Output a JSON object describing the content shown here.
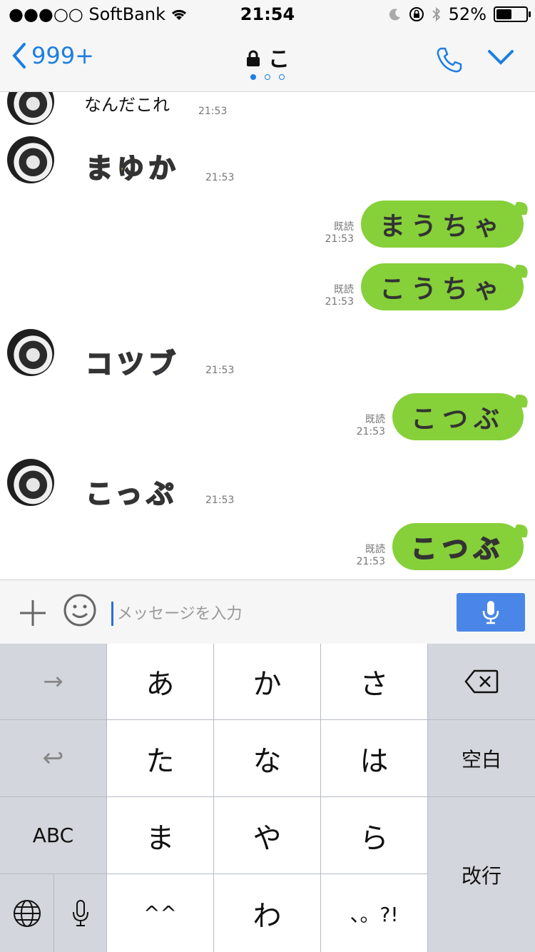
{
  "status_bar": {
    "carrier": "●●●○○ SoftBank",
    "time": "21:54",
    "battery": "52%",
    "battery_fraction": 0.52
  },
  "nav": {
    "back_label": "999+",
    "title": "こ",
    "page_dots": 3,
    "active_dot": 0
  },
  "messages": {
    "m1": {
      "text": "なんだこれ",
      "time": "21:53"
    },
    "m2": {
      "sticker": "まゆか",
      "time": "21:53"
    },
    "m3": {
      "text": "まうちゃ",
      "read": "既読",
      "time": "21:53"
    },
    "m4": {
      "text": "こうちゃ",
      "read": "既読",
      "time": "21:53"
    },
    "m5": {
      "sticker": "コツブ",
      "time": "21:53"
    },
    "m6": {
      "text": "こつぶ",
      "read": "既読",
      "time": "21:53"
    },
    "m7": {
      "sticker": "こっぷ",
      "time": "21:53"
    },
    "m8": {
      "text": "こつぶ",
      "read": "既読",
      "time": "21:53"
    }
  },
  "input": {
    "placeholder": "メッセージを入力",
    "value": ""
  },
  "keyboard": {
    "rows": [
      [
        "→",
        "あ",
        "か",
        "さ",
        "⌫"
      ],
      [
        "↩",
        "た",
        "な",
        "は",
        "空白"
      ],
      [
        "ABC",
        "ま",
        "や",
        "ら",
        "改行"
      ],
      [
        "🌐",
        "🎤",
        "^^",
        "わ",
        "、。?!"
      ]
    ],
    "next_label": "→",
    "undo_label": "↩",
    "abc_label": "ABC",
    "space_label": "空白",
    "return_label": "改行",
    "a": "あ",
    "ka": "か",
    "sa": "さ",
    "ta": "た",
    "na": "な",
    "ha": "は",
    "ma": "ま",
    "ya": "や",
    "ra": "ら",
    "face": "^^",
    "wa": "わ",
    "punct": "、。?!"
  },
  "colors": {
    "accent": "#1c7fe0",
    "bubble": "#86d03a",
    "mic": "#4a86e8"
  }
}
